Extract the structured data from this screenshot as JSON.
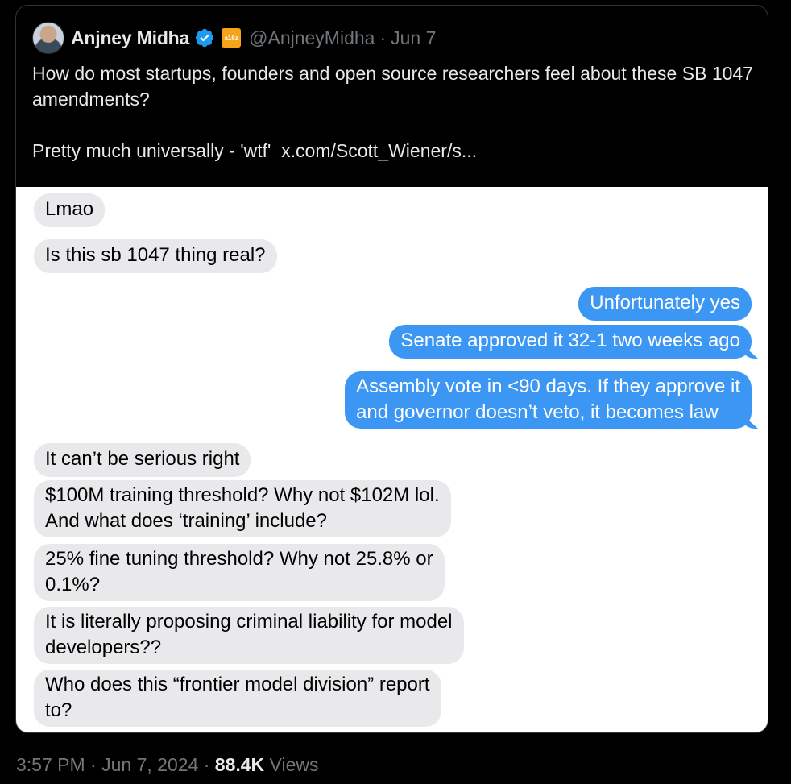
{
  "quoted_tweet": {
    "author_name": "Anjney Midha",
    "affiliation_badge": "a16z",
    "handle": "@AnjneyMidha",
    "separator": "·",
    "date": "Jun 7",
    "text_line1": "How do most startups, founders and open source researchers feel about these SB 1047 amendments?",
    "text_line2": "Pretty much universally - 'wtf'",
    "link_text": "x.com/Scott_Wiener/s..."
  },
  "chat": {
    "messages": [
      {
        "side": "in",
        "lines": [
          "Lmao"
        ]
      },
      {
        "side": "in",
        "lines": [
          "Is this sb 1047 thing real?"
        ]
      },
      {
        "side": "out",
        "lines": [
          "Unfortunately yes"
        ]
      },
      {
        "side": "out",
        "lines": [
          "Senate approved it 32-1 two weeks ago"
        ]
      },
      {
        "side": "out",
        "lines": [
          "Assembly vote in <90 days. If they approve it",
          "and governor doesn’t veto, it becomes law"
        ]
      },
      {
        "side": "in",
        "lines": [
          "It can’t be serious right"
        ]
      },
      {
        "side": "in",
        "lines": [
          "$100M training threshold? Why not $102M lol.",
          "And what does ‘training’ include?"
        ]
      },
      {
        "side": "in",
        "lines": [
          "25% fine tuning threshold? Why not 25.8% or",
          "0.1%?"
        ]
      },
      {
        "side": "in",
        "lines": [
          "It is literally proposing criminal liability for model",
          "developers??"
        ]
      },
      {
        "side": "in",
        "lines": [
          "Who does this “frontier model division” report",
          "to?"
        ]
      }
    ]
  },
  "meta": {
    "time": "3:57 PM",
    "separator": "·",
    "date": "Jun 7, 2024",
    "views_count": "88.4K",
    "views_label": "Views"
  },
  "colors": {
    "background": "#000000",
    "verified_blue": "#1d9bf0",
    "imessage_blue": "#3b97f3",
    "imessage_gray": "#e9e9eb",
    "muted_text": "#71767b"
  }
}
